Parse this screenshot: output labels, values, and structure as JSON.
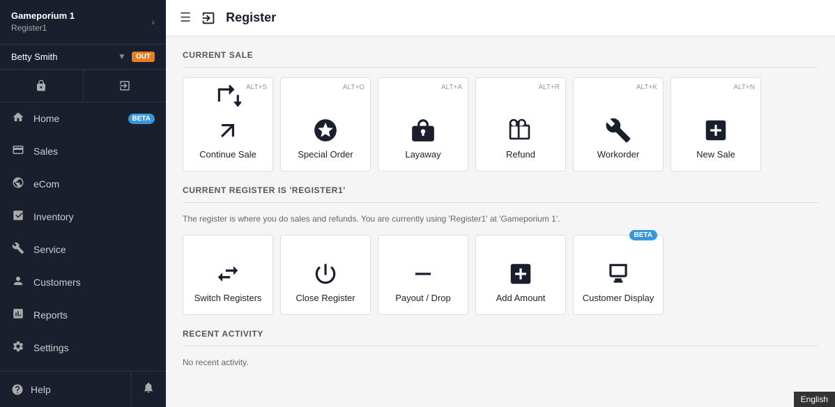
{
  "sidebar": {
    "brand_name": "Gameporium 1",
    "brand_sub": "Register1",
    "user_name": "Betty Smith",
    "user_badge": "OUT",
    "nav_items": [
      {
        "id": "home",
        "label": "Home",
        "badge": "BETA"
      },
      {
        "id": "sales",
        "label": "Sales",
        "badge": null
      },
      {
        "id": "ecom",
        "label": "eCom",
        "badge": null
      },
      {
        "id": "inventory",
        "label": "Inventory",
        "badge": null
      },
      {
        "id": "service",
        "label": "Service",
        "badge": null
      },
      {
        "id": "customers",
        "label": "Customers",
        "badge": null
      },
      {
        "id": "reports",
        "label": "Reports",
        "badge": null
      },
      {
        "id": "settings",
        "label": "Settings",
        "badge": null
      }
    ],
    "bottom": {
      "help_label": "Help"
    }
  },
  "topbar": {
    "title": "Register"
  },
  "main": {
    "current_sale_title": "CURRENT SALE",
    "register_section_title": "CURRENT REGISTER IS 'REGISTER1'",
    "register_info": "The register is where you do sales and refunds. You are currently using 'Register1'  at 'Gameporium 1'.",
    "recent_activity_title": "RECENT ACTIVITY",
    "recent_activity_empty": "No recent activity.",
    "current_sale_cards": [
      {
        "id": "continue-sale",
        "label": "Continue Sale",
        "shortcut": "ALT+S"
      },
      {
        "id": "special-order",
        "label": "Special Order",
        "shortcut": "ALT+O"
      },
      {
        "id": "layaway",
        "label": "Layaway",
        "shortcut": "ALT+A"
      },
      {
        "id": "refund",
        "label": "Refund",
        "shortcut": "ALT+R"
      },
      {
        "id": "workorder",
        "label": "Workorder",
        "shortcut": "ALT+K"
      },
      {
        "id": "new-sale",
        "label": "New Sale",
        "shortcut": "ALT+N"
      }
    ],
    "register_cards": [
      {
        "id": "switch-registers",
        "label": "Switch Registers",
        "shortcut": null,
        "beta": false
      },
      {
        "id": "close-register",
        "label": "Close Register",
        "shortcut": null,
        "beta": false
      },
      {
        "id": "payout-drop",
        "label": "Payout / Drop",
        "shortcut": null,
        "beta": false
      },
      {
        "id": "add-amount",
        "label": "Add Amount",
        "shortcut": null,
        "beta": false
      },
      {
        "id": "customer-display",
        "label": "Customer Display",
        "shortcut": null,
        "beta": true
      }
    ]
  },
  "footer": {
    "language": "English"
  }
}
